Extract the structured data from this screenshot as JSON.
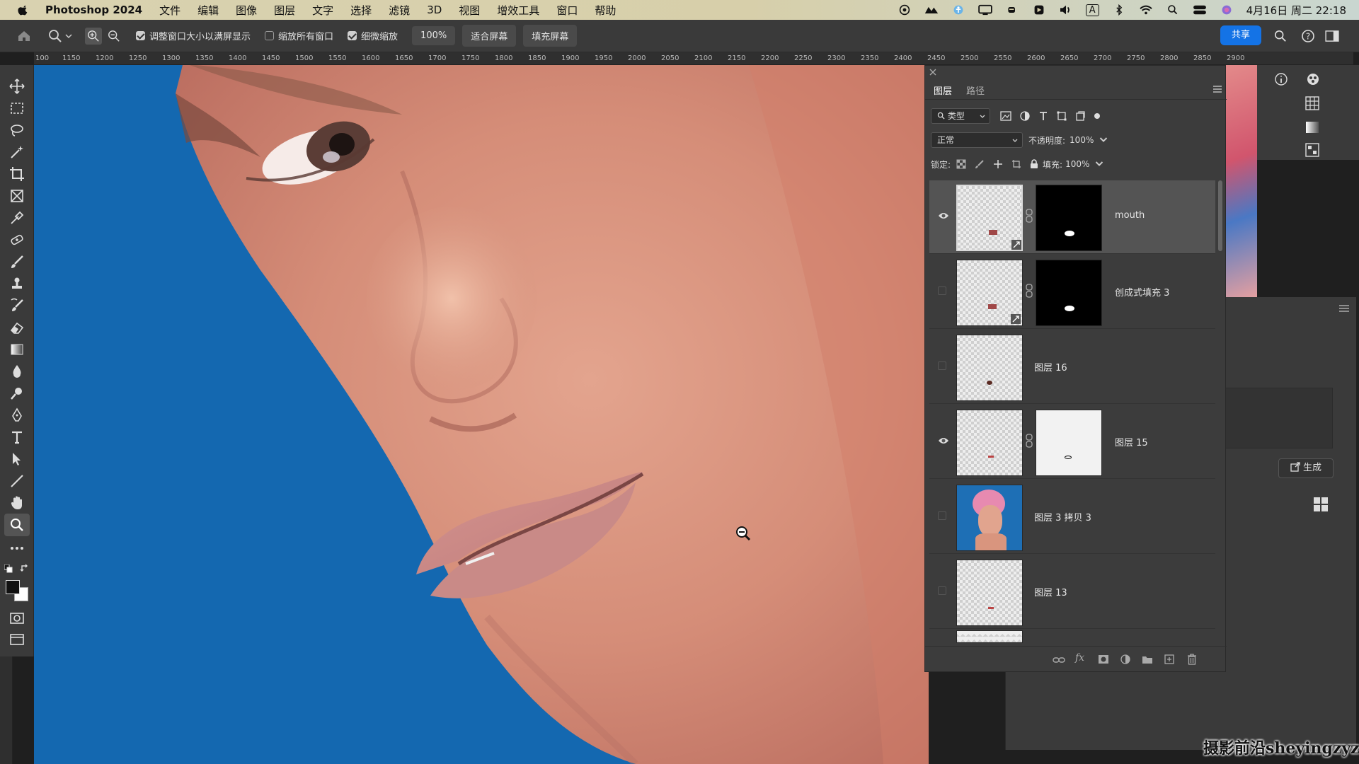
{
  "menubar": {
    "app_name": "Photoshop 2024",
    "items": [
      "文件",
      "编辑",
      "图像",
      "图层",
      "文字",
      "选择",
      "滤镜",
      "3D",
      "视图",
      "增效工具",
      "窗口",
      "帮助"
    ],
    "input_indicator": "A",
    "clock": "4月16日 周二 22:18"
  },
  "options_bar": {
    "resize_windows_label": "调整窗口大小以满屏显示",
    "zoom_all_windows_label": "缩放所有窗口",
    "scrubby_zoom_label": "细微缩放",
    "zoom_value": "100%",
    "fit_screen_label": "适合屏幕",
    "fill_screen_label": "填充屏幕",
    "share_label": "共享"
  },
  "ruler": {
    "ticks": [
      "100",
      "1150",
      "1200",
      "1250",
      "1300",
      "1350",
      "1400",
      "1450",
      "1500",
      "1550",
      "1600",
      "1650",
      "1700",
      "1750",
      "1800",
      "1850",
      "1900",
      "1950",
      "2000",
      "2050",
      "2100",
      "2150",
      "2200",
      "2250",
      "2300",
      "2350",
      "2400",
      "2450",
      "2500",
      "2550",
      "2600",
      "2650",
      "2700",
      "2750",
      "2800",
      "2850",
      "2900"
    ]
  },
  "layers_panel": {
    "tabs": [
      "图层",
      "路径"
    ],
    "filter_label": "类型",
    "blend_mode": "正常",
    "opacity_label": "不透明度:",
    "opacity_value": "100%",
    "lock_label": "锁定:",
    "fill_label": "填充:",
    "fill_value": "100%",
    "layers": [
      {
        "name": "mouth",
        "visible": true,
        "selected": true,
        "has_mask": true,
        "mask_bg": "#000000"
      },
      {
        "name": "创成式填充 3",
        "visible": false,
        "selected": false,
        "has_mask": true,
        "mask_bg": "#000000"
      },
      {
        "name": "图层 16",
        "visible": false,
        "selected": false,
        "has_mask": false
      },
      {
        "name": "图层 15",
        "visible": true,
        "selected": false,
        "has_mask": true,
        "mask_bg": "#ffffff"
      },
      {
        "name": "图层 3 拷贝 3",
        "visible": false,
        "selected": false,
        "has_mask": false
      },
      {
        "name": "图层 13",
        "visible": false,
        "selected": false,
        "has_mask": false
      }
    ]
  },
  "properties_panel": {
    "generate_label": "生成"
  },
  "watermark": "摄影前沿sheyingzyz.com",
  "colors": {
    "canvas_bg": "#1468b0",
    "accent": "#1473e6",
    "panel_bg": "#3c3c3c"
  }
}
